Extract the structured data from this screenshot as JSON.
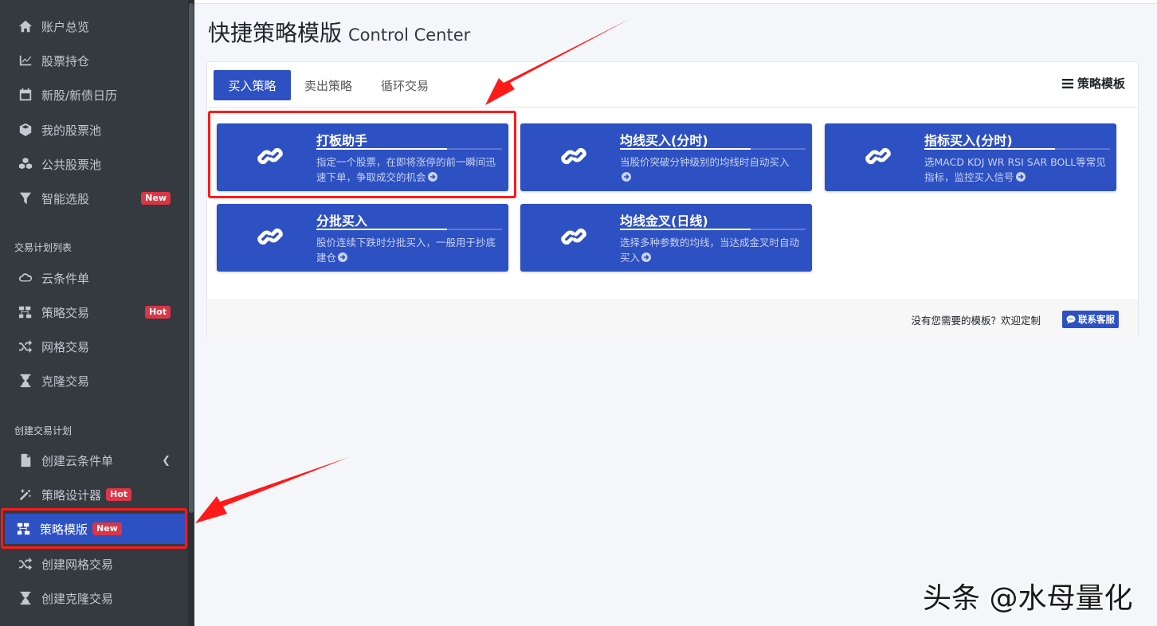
{
  "sidebar": {
    "items": [
      {
        "label": "账户总览",
        "icon": "home-icon"
      },
      {
        "label": "股票持仓",
        "icon": "line-chart-icon"
      },
      {
        "label": "新股/新债日历",
        "icon": "calendar-icon"
      },
      {
        "label": "我的股票池",
        "icon": "cube-icon"
      },
      {
        "label": "公共股票池",
        "icon": "cubes-icon"
      },
      {
        "label": "智能选股",
        "icon": "filter-icon",
        "badge": "New"
      }
    ],
    "header_plans": "交易计划列表",
    "plans": [
      {
        "label": "云条件单",
        "icon": "cloud-icon"
      },
      {
        "label": "策略交易",
        "icon": "sitemap-icon",
        "badge": "Hot"
      },
      {
        "label": "网格交易",
        "icon": "random-icon"
      },
      {
        "label": "克隆交易",
        "icon": "hourglass-icon"
      }
    ],
    "header_create": "创建交易计划",
    "create": [
      {
        "label": "创建云条件单",
        "icon": "file-icon"
      },
      {
        "label": "策略设计器",
        "icon": "magic-icon",
        "badge": "Hot"
      },
      {
        "label": "策略模版",
        "icon": "sitemap-icon",
        "badge": "New"
      },
      {
        "label": "创建网格交易",
        "icon": "random-icon"
      },
      {
        "label": "创建克隆交易",
        "icon": "hourglass-icon"
      }
    ]
  },
  "page": {
    "title": "快捷策略模版",
    "subtitle": "Control Center"
  },
  "tabs": [
    "买入策略",
    "卖出策略",
    "循环交易"
  ],
  "tools_label": "策略模板",
  "tiles": [
    {
      "title": "打板助手",
      "desc": "指定一个股票，在即将涨停的前一瞬间迅速下单，争取成交的机会"
    },
    {
      "title": "均线买入(分时)",
      "desc": "当股价突破分钟级别的均线时自动买入"
    },
    {
      "title": "指标买入(分时)",
      "desc": "选MACD KDJ WR RSI SAR BOLL等常见指标，监控买入信号"
    },
    {
      "title": "分批买入",
      "desc": "股价连续下跌时分批买入，一般用于抄底建仓"
    },
    {
      "title": "均线金叉(日线)",
      "desc": "选择多种参数的均线，当达成金叉时自动买入"
    }
  ],
  "footer": {
    "text": "没有您需要的模板？欢迎定制",
    "button": "联系客服"
  },
  "watermark": "头条 @水母量化",
  "colors": {
    "sidebar_bg": "#343a40",
    "primary": "#2d50c2",
    "badge": "#dc3545",
    "annotation": "#ff1a1a"
  }
}
